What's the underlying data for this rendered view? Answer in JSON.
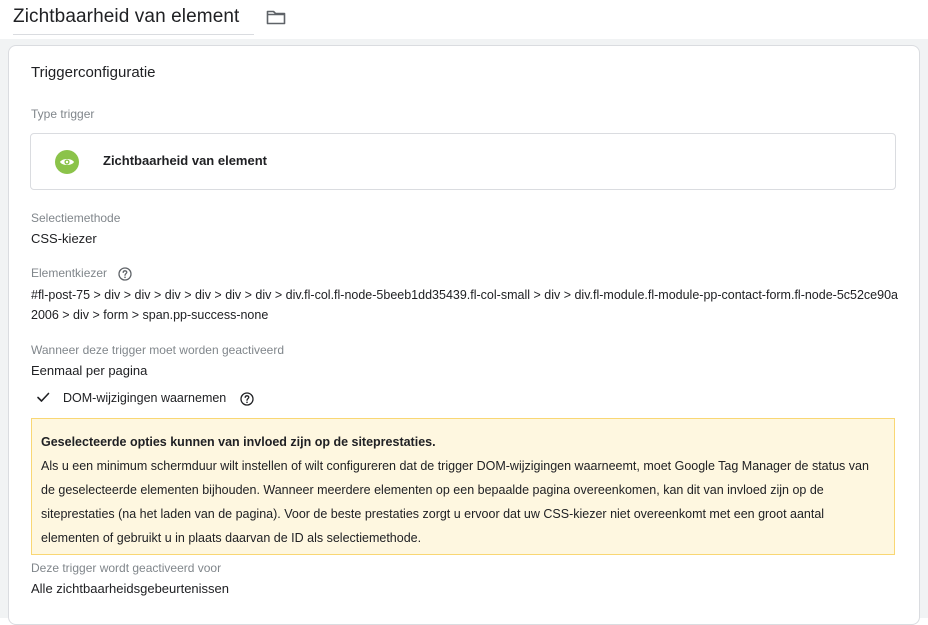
{
  "header": {
    "title": "Zichtbaarheid van element",
    "folder_icon": "folder-icon"
  },
  "card": {
    "title": "Triggerconfiguratie",
    "trigger_type": {
      "label": "Type trigger",
      "name": "Zichtbaarheid van element",
      "icon": "eye-icon",
      "icon_color": "#8bc34a"
    },
    "selection_method": {
      "label": "Selectiemethode",
      "value": "CSS-kiezer"
    },
    "element_selector": {
      "label": "Elementkiezer",
      "help_icon": "help-icon",
      "value": "#fl-post-75 > div > div > div > div > div > div > div.fl-col.fl-node-5beeb1dd35439.fl-col-small > div > div.fl-module.fl-module-pp-contact-form.fl-node-5c52ce90a2006 > div > form > span.pp-success-none"
    },
    "fire_when": {
      "label": "Wanneer deze trigger moet worden geactiveerd",
      "value": "Eenmaal per pagina"
    },
    "observe_dom": {
      "label": "DOM-wijzigingen waarnemen",
      "checked": true,
      "check_icon": "check-icon",
      "help_icon": "help-icon"
    },
    "warning": {
      "heading": "Geselecteerde opties kunnen van invloed zijn op de siteprestaties.",
      "body": "Als u een minimum schermduur wilt instellen of wilt configureren dat de trigger DOM-wijzigingen waarneemt, moet Google Tag Manager de status van de geselecteerde elementen bijhouden. Wanneer meerdere elementen op een bepaalde pagina overeenkomen, kan dit van invloed zijn op de siteprestaties (na het laden van de pagina). Voor de beste prestaties zorgt u ervoor dat uw CSS-kiezer niet overeenkomt met een groot aantal elementen of gebruikt u in plaats daarvan de ID als selectiemethode.",
      "background": "#fef7e0"
    },
    "fires_on": {
      "label": "Deze trigger wordt geactiveerd voor",
      "value": "Alle zichtbaarheidsgebeurtenissen"
    }
  }
}
